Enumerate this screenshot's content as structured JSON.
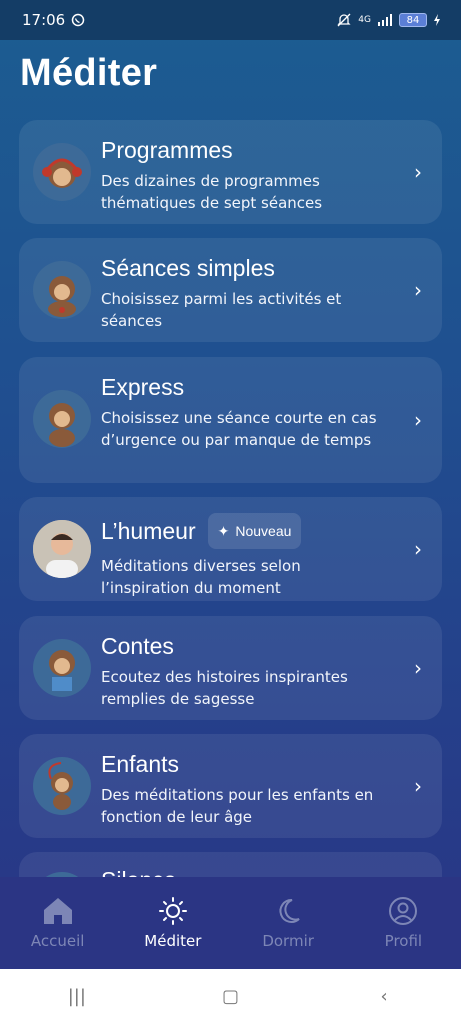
{
  "status_bar": {
    "time": "17:06",
    "network": "4G",
    "battery": "84"
  },
  "page": {
    "title": "Méditer"
  },
  "cards": [
    {
      "title": "Programmes",
      "description": "Des dizaines de programmes thématiques de sept séances"
    },
    {
      "title": "Séances simples",
      "description": "Choisissez parmi les activités et séances"
    },
    {
      "title": "Express",
      "description": "Choisissez une séance courte en cas d’urgence ou par manque de temps"
    },
    {
      "title": "L’humeur",
      "badge": "Nouveau",
      "description": "Méditations diverses selon l’inspiration du moment"
    },
    {
      "title": "Contes",
      "description": "Ecoutez des histoires inspirantes remplies de sagesse"
    },
    {
      "title": "Enfants",
      "description": "Des méditations pour les enfants en fonction de leur âge"
    },
    {
      "title": "Silence"
    }
  ],
  "bottom_nav": [
    {
      "label": "Accueil",
      "icon": "home-icon"
    },
    {
      "label": "Méditer",
      "icon": "sun-icon",
      "active": true
    },
    {
      "label": "Dormir",
      "icon": "moon-icon"
    },
    {
      "label": "Profil",
      "icon": "user-icon"
    }
  ]
}
